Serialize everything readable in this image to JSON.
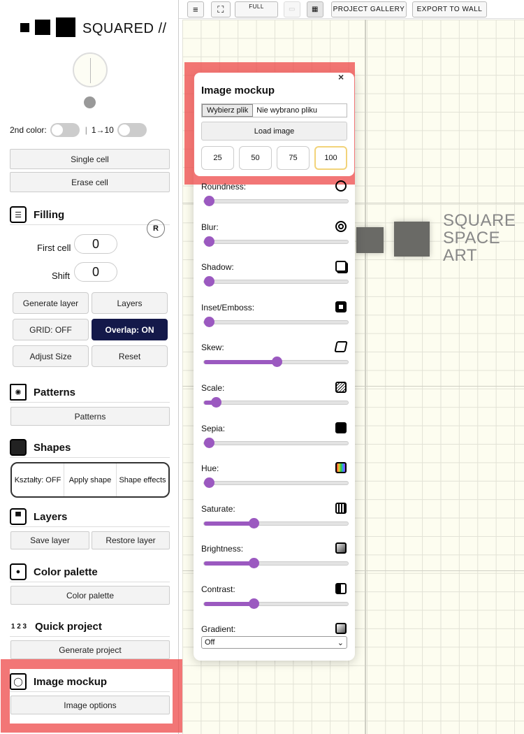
{
  "logo": {
    "text": "SQUARED //"
  },
  "toggles": {
    "second_color_label": "2nd color:",
    "range_label": "1→10"
  },
  "buttons": {
    "single_cell": "Single cell",
    "erase_cell": "Erase cell"
  },
  "filling": {
    "title": "Filling",
    "reset_badge": "R",
    "first_cell_label": "First cell",
    "first_cell_value": "0",
    "shift_label": "Shift",
    "shift_value": "0",
    "generate_layer": "Generate layer",
    "layers": "Layers",
    "grid": "GRID: OFF",
    "overlap": "Overlap: ON",
    "adjust_size": "Adjust Size",
    "reset": "Reset"
  },
  "patterns": {
    "title": "Patterns",
    "button": "Patterns"
  },
  "shapes": {
    "title": "Shapes",
    "ksztalty": "Kształty: OFF",
    "apply_shape": "Apply shape",
    "shape_effects": "Shape effects"
  },
  "layers": {
    "title": "Layers",
    "save": "Save layer",
    "restore": "Restore layer"
  },
  "color_palette": {
    "title": "Color palette",
    "button": "Color palette"
  },
  "quick_project": {
    "title": "Quick project",
    "icon_text": "1 2 3",
    "button": "Generate project"
  },
  "image_mockup_section": {
    "title": "Image mockup",
    "button": "Image options"
  },
  "toolbar": {
    "full": "FULL",
    "gallery": "PROJECT GALLERY",
    "export": "EXPORT TO WALL"
  },
  "canvas": {
    "art_line1": "SQUARE",
    "art_line2": "SPACE",
    "art_line3": "ART"
  },
  "panel": {
    "close": "×",
    "title": "Image mockup",
    "choose_file": "Wybierz plik",
    "no_file": "Nie wybrano pliku",
    "load_image": "Load image",
    "sizes": [
      "25",
      "50",
      "75",
      "100"
    ],
    "active_size": "100",
    "sliders": [
      {
        "label": "Roundness:",
        "icon": "roundness-icon",
        "value": 0.03
      },
      {
        "label": "Blur:",
        "icon": "blur-icon",
        "value": 0.03
      },
      {
        "label": "Shadow:",
        "icon": "shadow-icon",
        "value": 0.03
      },
      {
        "label": "Inset/Emboss:",
        "icon": "inset-icon",
        "value": 0.03
      },
      {
        "label": "Skew:",
        "icon": "skew-icon",
        "value": 0.5
      },
      {
        "label": "Scale:",
        "icon": "scale-icon",
        "value": 0.08
      },
      {
        "label": "Sepia:",
        "icon": "sepia-icon",
        "value": 0.03
      },
      {
        "label": "Hue:",
        "icon": "hue-icon",
        "value": 0.03
      },
      {
        "label": "Saturate:",
        "icon": "saturate-icon",
        "value": 0.34
      },
      {
        "label": "Brightness:",
        "icon": "brightness-icon",
        "value": 0.34
      },
      {
        "label": "Contrast:",
        "icon": "contrast-icon",
        "value": 0.34
      }
    ],
    "gradient_label": "Gradient:",
    "gradient_value": "Off"
  },
  "colors": {
    "accent": "#9b59c0",
    "dark_button": "#14194a",
    "highlight": "#ee4848",
    "canvas": "#fdfdf0"
  }
}
